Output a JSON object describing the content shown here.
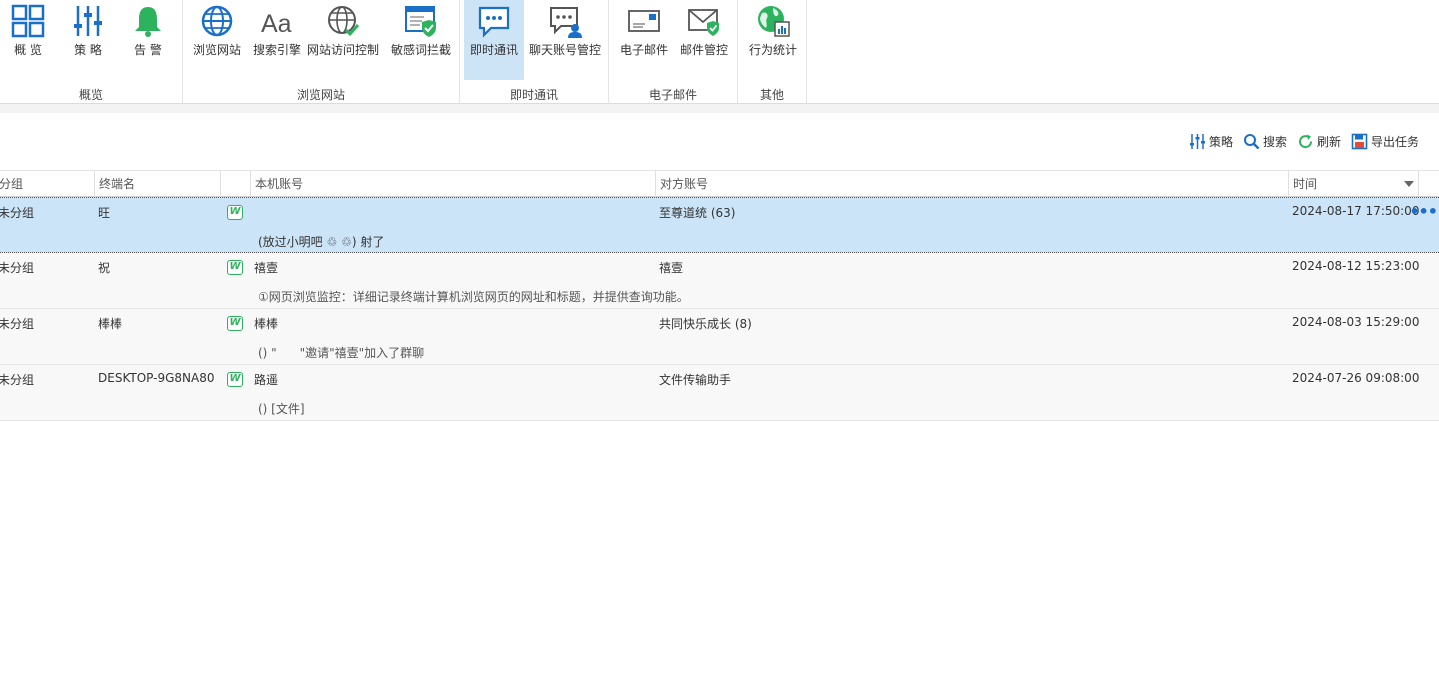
{
  "ribbon": {
    "groups": [
      {
        "label": "概览",
        "buttons": [
          {
            "label": "概 览",
            "icon": "grid-icon"
          },
          {
            "label": "策 略",
            "icon": "sliders-icon"
          },
          {
            "label": "告 警",
            "icon": "bell-icon"
          }
        ]
      },
      {
        "label": "浏览网站",
        "buttons": [
          {
            "label": "浏览网站",
            "icon": "globe-icon"
          },
          {
            "label": "搜索引擎",
            "icon": "font-aa-icon"
          },
          {
            "label": "网站访问控制",
            "icon": "globe-check-icon"
          },
          {
            "label": "敏感词拦截",
            "icon": "browser-shield-icon"
          }
        ]
      },
      {
        "label": "即时通讯",
        "buttons": [
          {
            "label": "即时通讯",
            "icon": "chat-bubble-icon"
          },
          {
            "label": "聊天账号管控",
            "icon": "chat-user-icon"
          }
        ]
      },
      {
        "label": "电子邮件",
        "buttons": [
          {
            "label": "电子邮件",
            "icon": "envelope-icon"
          },
          {
            "label": "邮件管控",
            "icon": "envelope-shield-icon"
          }
        ]
      },
      {
        "label": "其他",
        "buttons": [
          {
            "label": "行为统计",
            "icon": "globe-stats-icon"
          }
        ]
      }
    ]
  },
  "toolbar": {
    "policy": "策略",
    "search": "搜索",
    "refresh": "刷新",
    "export": "导出任务"
  },
  "table": {
    "columns": {
      "group": "分组",
      "terminal": "终端名",
      "local_account": "本机账号",
      "peer_account": "对方账号",
      "time": "时间"
    },
    "rows": [
      {
        "group": "未分组",
        "terminal": "旺",
        "local_account": "",
        "peer_account": "至尊道统 (63)",
        "time": "2024-08-17 17:50:00",
        "message": "(放过小明吧 ♲ ♲) 射了",
        "selected": true
      },
      {
        "group": "未分组",
        "terminal": "祝",
        "local_account": "禧壹",
        "peer_account": "禧壹",
        "time": "2024-08-12 15:23:00",
        "message": "①网页浏览监控：详细记录终端计算机浏览网页的网址和标题，并提供查询功能。",
        "selected": false
      },
      {
        "group": "未分组",
        "terminal": "棒棒",
        "local_account": "棒棒",
        "peer_account": "共同快乐成长 (8)",
        "time": "2024-08-03 15:29:00",
        "message": "() \"      \"邀请\"禧壹\"加入了群聊",
        "selected": false
      },
      {
        "group": "未分组",
        "terminal": "DESKTOP-9G8NA80",
        "local_account": "路遥",
        "peer_account": "文件传输助手",
        "time": "2024-07-26 09:08:00",
        "message": "() [文件]",
        "selected": false
      }
    ],
    "app_icon_letter": "W",
    "more_glyph": "•••"
  },
  "colors": {
    "accent": "#1a6fc9",
    "selected_row": "#cce4f7",
    "active_tab": "#cde3f6",
    "wechat_green": "#2db35d"
  }
}
